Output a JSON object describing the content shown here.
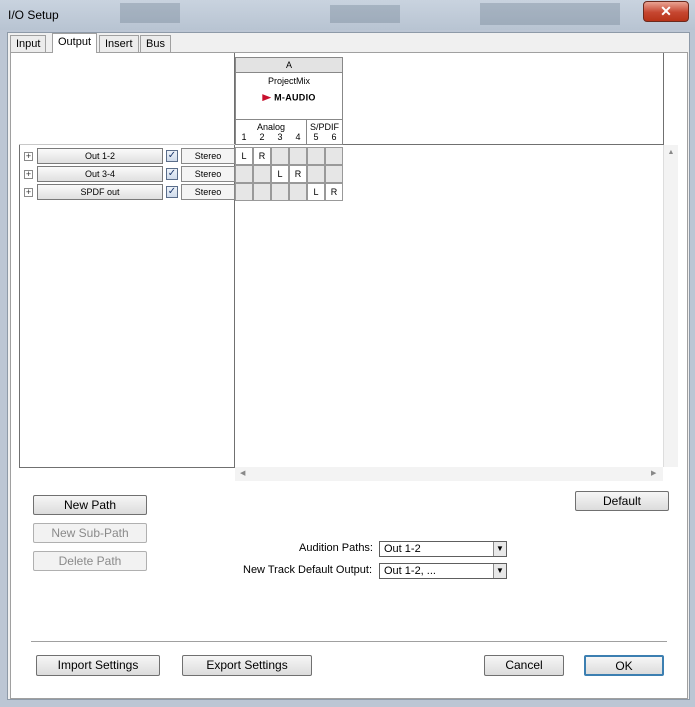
{
  "window": {
    "title": "I/O Setup",
    "close_label": "✕"
  },
  "tabs": [
    {
      "label": "Input"
    },
    {
      "label": "Output"
    },
    {
      "label": "Insert"
    },
    {
      "label": "Bus"
    }
  ],
  "grid": {
    "group": "A",
    "device": "ProjectMix",
    "brand": "M-AUDIO",
    "sub_analog": "Analog",
    "sub_spdif": "S/PDIF",
    "channels": [
      "1",
      "2",
      "3",
      "4",
      "5",
      "6"
    ]
  },
  "paths": [
    {
      "name": "Out 1-2",
      "format": "Stereo",
      "cells": [
        "L",
        "R",
        "",
        "",
        "",
        ""
      ]
    },
    {
      "name": "Out 3-4",
      "format": "Stereo",
      "cells": [
        "",
        "",
        "L",
        "R",
        "",
        ""
      ]
    },
    {
      "name": "SPDF out",
      "format": "Stereo",
      "cells": [
        "",
        "",
        "",
        "",
        "L",
        "R"
      ]
    }
  ],
  "buttons": {
    "new_path": "New Path",
    "new_sub_path": "New Sub-Path",
    "delete_path": "Delete Path",
    "default": "Default",
    "import": "Import Settings",
    "export": "Export Settings",
    "cancel": "Cancel",
    "ok": "OK"
  },
  "audition": {
    "label": "Audition Paths:",
    "value": "Out 1-2"
  },
  "new_track": {
    "label": "New Track Default Output:",
    "value": "Out 1-2, ..."
  },
  "icons": {
    "check": "✓",
    "plus": "+",
    "dropdown": "▼",
    "scroll_up": "▲",
    "scroll_left": "◀",
    "scroll_right": "▶"
  }
}
